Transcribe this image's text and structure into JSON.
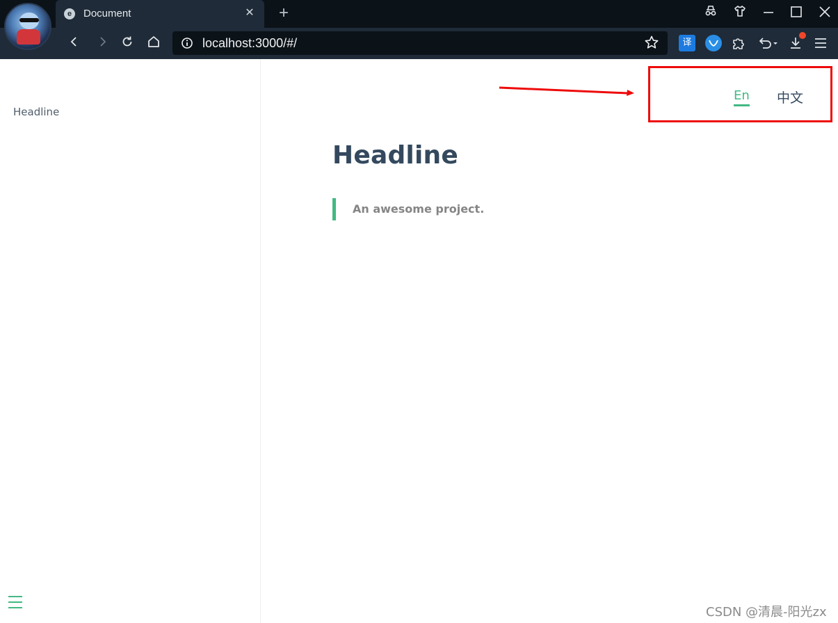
{
  "browser": {
    "tab_title": "Document",
    "tab_favicon_glyph": "e",
    "tab_close": "✕",
    "new_tab": "+",
    "address": "localhost:3000/#/",
    "translate_badge": "译",
    "icons": [
      "user-avatar-icon",
      "incognito-icon",
      "shirt-skin-icon",
      "minimize-icon",
      "maximize-icon",
      "close-icon",
      "back-icon",
      "forward-icon",
      "reload-icon",
      "home-icon",
      "info-icon",
      "star-icon",
      "translate-icon",
      "shield-extension-icon",
      "extensions-puzzle-icon",
      "undo-icon",
      "download-icon",
      "menu-icon"
    ],
    "accent_badge_color": "#f0472b"
  },
  "sidebar": {
    "items": [
      {
        "label": "Headline"
      }
    ]
  },
  "nav": {
    "languages": [
      {
        "label": "En",
        "active": true
      },
      {
        "label": "中文",
        "active": false
      }
    ],
    "active_color": "#42b983"
  },
  "main": {
    "title": "Headline",
    "blockquote": "An awesome project."
  },
  "annotation": {
    "color": "#ee0a0a"
  },
  "watermark": "CSDN @清晨-阳光zx"
}
